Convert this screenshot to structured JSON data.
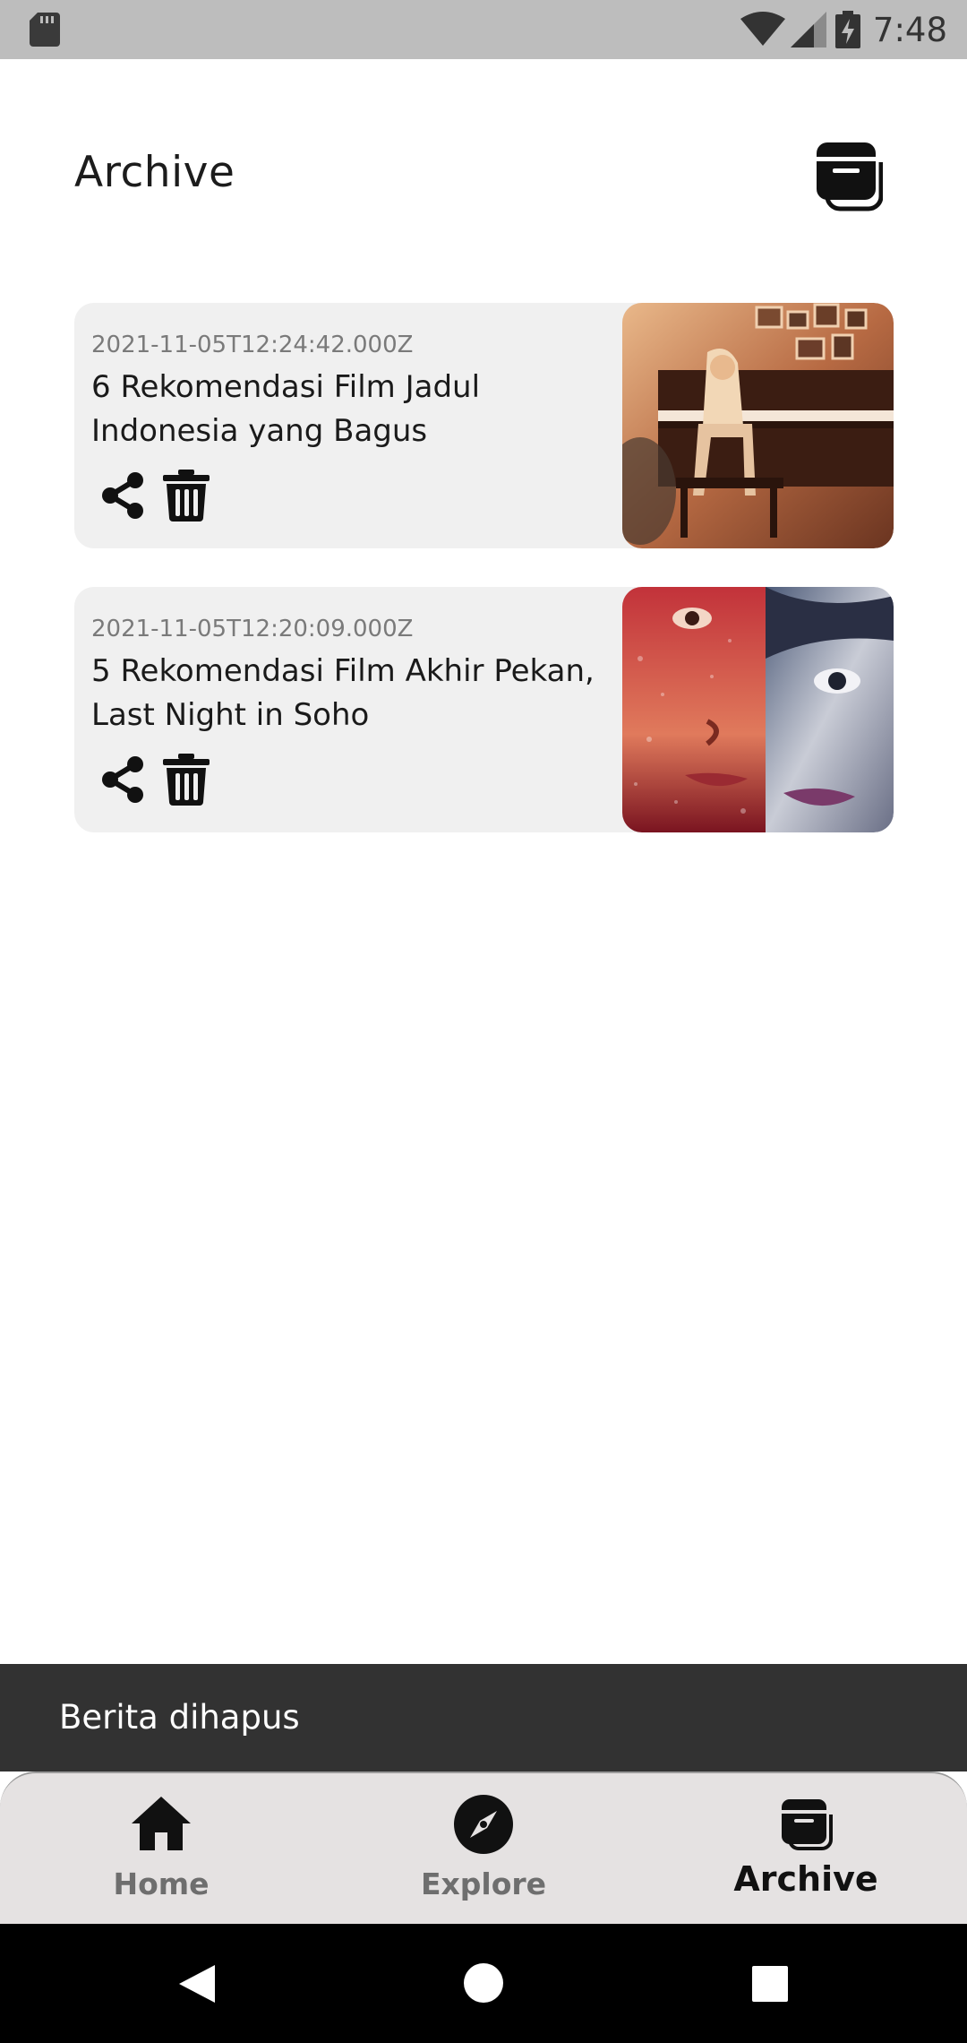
{
  "status_bar": {
    "time": "7:48",
    "icons": [
      "sd-card-icon",
      "wifi-icon",
      "cell-signal-icon",
      "battery-charging-icon"
    ]
  },
  "header": {
    "title": "Archive",
    "icon": "archive-icon"
  },
  "articles": [
    {
      "date": "2021-11-05T12:24:42.000Z",
      "title": "6 Rekomendasi Film Jadul Indonesia yang Bagus",
      "thumbnail": "girl-at-piano-image",
      "actions": [
        "share-icon",
        "trash-icon"
      ]
    },
    {
      "date": "2021-11-05T12:20:09.000Z",
      "title": "5 Rekomendasi Film Akhir Pekan, Last Night in Soho",
      "thumbnail": "split-face-poster-image",
      "actions": [
        "share-icon",
        "trash-icon"
      ]
    }
  ],
  "snackbar": {
    "message": "Berita dihapus"
  },
  "bottom_nav": {
    "items": [
      {
        "label": "Home",
        "icon": "home-icon",
        "active": false
      },
      {
        "label": "Explore",
        "icon": "compass-icon",
        "active": false
      },
      {
        "label": "Archive",
        "icon": "archive-icon",
        "active": true
      }
    ]
  },
  "system_nav": {
    "buttons": [
      "back-icon",
      "home-circle-icon",
      "recents-icon"
    ]
  },
  "colors": {
    "status_bar": "#bdbdbd",
    "card_background": "#f0f0f0",
    "snackbar": "#323232",
    "bottom_nav": "#e5e2e2",
    "nav_active": "#111111",
    "nav_inactive": "#6e6e6e"
  }
}
